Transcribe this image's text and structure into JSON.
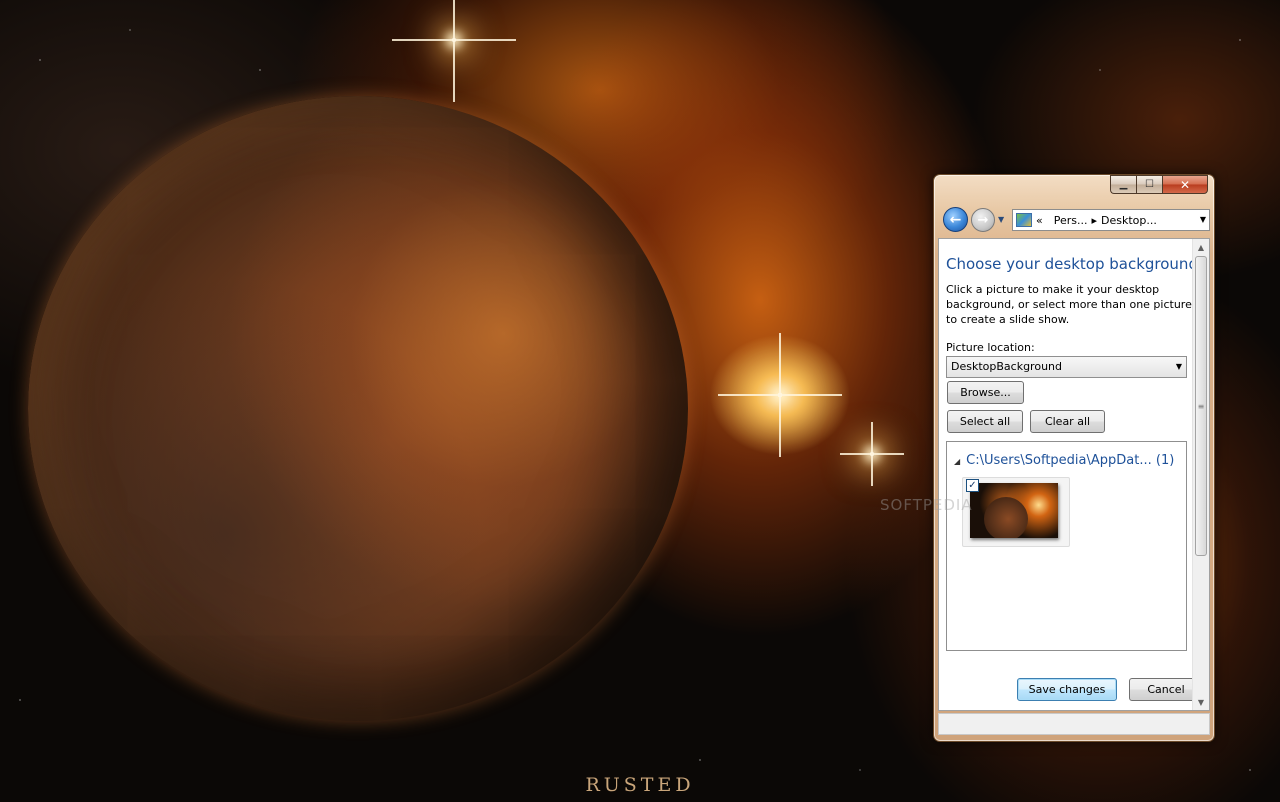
{
  "wallpaper": {
    "caption": "RUSTED"
  },
  "window": {
    "caption_buttons": {
      "minimize_icon": "minimize-icon",
      "maximize_icon": "maximize-icon",
      "close_icon": "close-icon"
    },
    "nav": {
      "back_icon": "back-arrow-icon",
      "forward_icon": "forward-arrow-icon"
    },
    "address": {
      "chevron": "«",
      "segments": [
        "Pers...",
        "Desktop..."
      ],
      "separator": "▸"
    },
    "content": {
      "title": "Choose your desktop background",
      "description": "Click a picture to make it your desktop background, or select more than one picture to create a slide show.",
      "picture_location_label": "Picture location:",
      "picture_location_value": "DesktopBackground",
      "browse_label": "Browse...",
      "select_all_label": "Select all",
      "clear_all_label": "Clear all",
      "gallery": {
        "group_title": "C:\\Users\\Softpedia\\AppDat... (1)",
        "items": [
          {
            "selected": true
          }
        ]
      }
    },
    "buttons": {
      "save_label": "Save changes",
      "cancel_label": "Cancel"
    }
  },
  "watermark": "SOFTPEDIA",
  "colors": {
    "title_blue": "#1e5199",
    "window_frame": "#e8c9a6",
    "default_button": "#bee6fd"
  }
}
